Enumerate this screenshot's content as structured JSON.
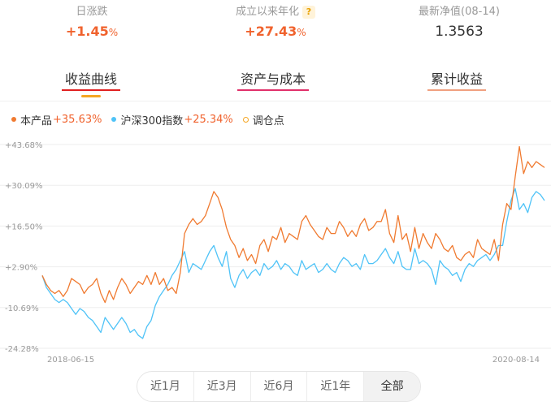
{
  "stats": [
    {
      "label": "日涨跌",
      "value": "+1.45",
      "unit": "%",
      "kind": "up",
      "help": false
    },
    {
      "label": "成立以来年化",
      "value": "+27.43",
      "unit": "%",
      "kind": "up",
      "help": true
    },
    {
      "label": "最新净值(08-14)",
      "value": "1.3563",
      "unit": "",
      "kind": "neutral",
      "help": false
    }
  ],
  "help_icon": "?",
  "tabs": [
    {
      "label": "收益曲线",
      "underline_color": "#e02020",
      "active": true
    },
    {
      "label": "资产与成本",
      "underline_color": "#e0306a",
      "active": false
    },
    {
      "label": "累计收益",
      "underline_color": "#f0a080",
      "active": false
    }
  ],
  "legend": {
    "product": {
      "name": "本产品",
      "value": "+35.63%",
      "color": "#f07a30"
    },
    "index": {
      "name": "沪深300指数",
      "value": "+25.34%",
      "color": "#4fc3f7"
    },
    "rebalance": {
      "name": "调仓点",
      "color": "#f5a623"
    }
  },
  "range_buttons": [
    {
      "label": "近1月",
      "active": false
    },
    {
      "label": "近3月",
      "active": false
    },
    {
      "label": "近6月",
      "active": false
    },
    {
      "label": "近1年",
      "active": false
    },
    {
      "label": "全部",
      "active": true
    }
  ],
  "chart_data": {
    "type": "line",
    "y_ticks": [
      "+43.68%",
      "+30.09%",
      "+16.50%",
      "+2.90%",
      "-10.69%",
      "-24.28%"
    ],
    "y_tick_values": [
      43.68,
      30.09,
      16.5,
      2.9,
      -10.69,
      -24.28
    ],
    "ylim": [
      -24.28,
      43.68
    ],
    "x_start_label": "2018-06-15",
    "x_end_label": "2020-08-14",
    "grid": true,
    "series": [
      {
        "name": "本产品",
        "color": "#f07a30",
        "values": [
          0,
          -3,
          -5,
          -6,
          -5,
          -7,
          -5,
          -1,
          -2,
          -3,
          -6,
          -4,
          -3,
          -1,
          -6,
          -9,
          -5,
          -8,
          -4,
          -1,
          -3,
          -6,
          -4,
          -2,
          -3,
          0,
          -3,
          1,
          -3,
          -1,
          -5,
          -4,
          -6,
          1,
          14,
          17,
          19,
          17,
          18,
          20,
          24,
          28,
          26,
          22,
          16,
          12,
          10,
          6,
          9,
          5,
          7,
          4,
          10,
          12,
          8,
          13,
          12,
          16,
          11,
          14,
          13,
          12,
          18,
          20,
          17,
          15,
          13,
          12,
          16,
          14,
          14,
          18,
          16,
          13,
          15,
          13,
          17,
          19,
          15,
          16,
          18,
          18,
          22,
          14,
          11,
          20,
          12,
          14,
          8,
          16,
          9,
          14,
          11,
          9,
          14,
          12,
          9,
          8,
          10,
          6,
          5,
          7,
          8,
          6,
          12,
          9,
          8,
          7,
          12,
          5,
          17,
          24,
          22,
          33,
          43,
          34,
          38,
          36,
          38,
          37,
          36
        ]
      },
      {
        "name": "沪深300指数",
        "color": "#4fc3f7",
        "values": [
          0,
          -4,
          -6,
          -8,
          -9,
          -8,
          -9,
          -11,
          -13,
          -11,
          -12,
          -14,
          -15,
          -17,
          -19,
          -14,
          -16,
          -18,
          -16,
          -14,
          -16,
          -19,
          -18,
          -20,
          -21,
          -17,
          -15,
          -10,
          -7,
          -5,
          -3,
          0,
          2,
          5,
          8,
          1,
          4,
          3,
          2,
          5,
          8,
          10,
          6,
          3,
          8,
          -1,
          -4,
          0,
          2,
          -1,
          1,
          2,
          0,
          4,
          2,
          3,
          5,
          2,
          4,
          3,
          1,
          0,
          5,
          2,
          3,
          4,
          1,
          2,
          4,
          2,
          1,
          4,
          6,
          5,
          3,
          4,
          2,
          7,
          4,
          4,
          5,
          7,
          9,
          6,
          4,
          8,
          3,
          2,
          2,
          9,
          4,
          5,
          4,
          2,
          -3,
          5,
          3,
          2,
          0,
          1,
          -2,
          2,
          4,
          3,
          5,
          6,
          7,
          5,
          7,
          10,
          10,
          18,
          25,
          29,
          22,
          24,
          21,
          26,
          28,
          27,
          25
        ]
      }
    ]
  }
}
